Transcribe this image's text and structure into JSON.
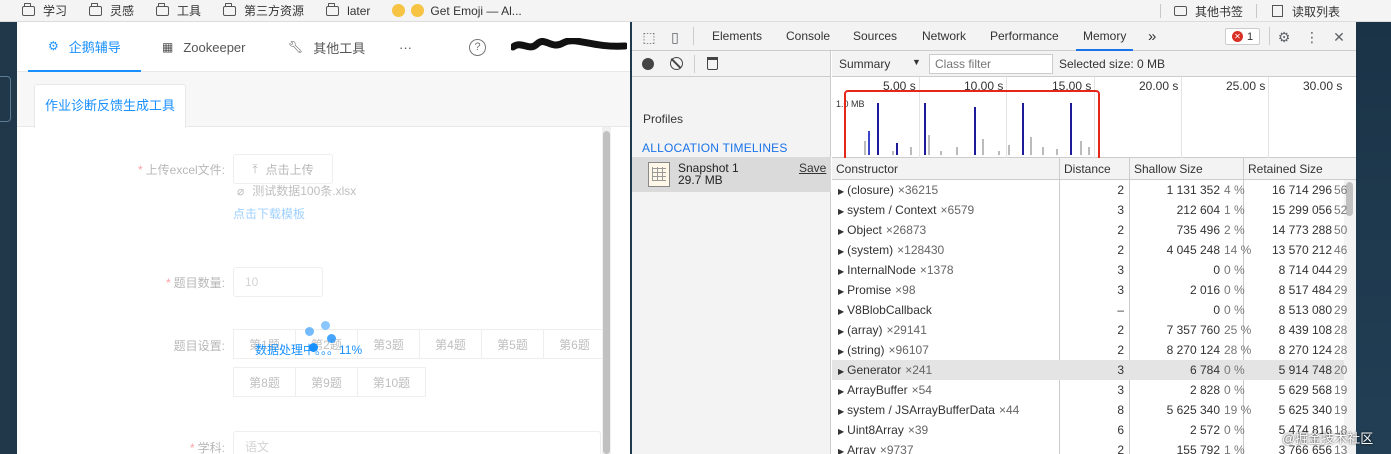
{
  "bookmarks": {
    "items": [
      "学习",
      "灵感",
      "工具",
      "第三方资源",
      "later",
      "Get Emoji — Al..."
    ],
    "right": [
      "其他书签",
      "读取列表"
    ]
  },
  "app": {
    "nav": [
      {
        "label": "企鹅辅导",
        "icon": "penguin-icon"
      },
      {
        "label": "Zookeeper",
        "icon": "grid-icon"
      },
      {
        "label": "其他工具",
        "icon": "wrench-icon"
      },
      {
        "label": "···",
        "icon": ""
      }
    ],
    "help_glyph": "?",
    "tab_label": "作业诊断反馈生成工具",
    "form": {
      "upload_label": "上传excel文件:",
      "upload_button": "点击上传",
      "file_name": "测试数据100条.xlsx",
      "download_link": "点击下载模板",
      "count_label": "题目数量:",
      "count_value": "10",
      "settings_label": "题目设置:",
      "questions_row1": [
        "第1题",
        "第2题",
        "第3题",
        "第4题",
        "第5题",
        "第6题"
      ],
      "questions_row2": [
        "第8题",
        "第9题",
        "第10题"
      ],
      "subject_label": "学科:",
      "subject_placeholder": "语文"
    },
    "loading_text": "数据处理中。。。11%"
  },
  "devtools": {
    "tabs": [
      "Elements",
      "Console",
      "Sources",
      "Network",
      "Performance",
      "Memory"
    ],
    "active_tab": "Memory",
    "more": "»",
    "error_count": "1",
    "view_select": "Summary",
    "class_filter_placeholder": "Class filter",
    "selected_size": "Selected size: 0 MB",
    "profiles_heading": "Profiles",
    "section_heading": "ALLOCATION TIMELINES",
    "snapshot": {
      "name": "Snapshot 1",
      "size": "29.7 MB",
      "save": "Save"
    },
    "timeline": {
      "ticks": [
        "5.00 s",
        "10.00 s",
        "15.00 s",
        "20.00 s",
        "25.00 s",
        "30.00 s"
      ],
      "scale_label": "1.0 MB"
    },
    "columns": [
      "Constructor",
      "Distance",
      "Shallow Size",
      "Retained Size"
    ],
    "rows": [
      {
        "name": "(closure)",
        "count": "×36215",
        "distance": "2",
        "shallow": "1 131 352",
        "shallow_pct": "4 %",
        "retained": "16 714 296",
        "retained_pct": "56"
      },
      {
        "name": "system / Context",
        "count": "×6579",
        "distance": "3",
        "shallow": "212 604",
        "shallow_pct": "1 %",
        "retained": "15 299 056",
        "retained_pct": "52"
      },
      {
        "name": "Object",
        "count": "×26873",
        "distance": "2",
        "shallow": "735 496",
        "shallow_pct": "2 %",
        "retained": "14 773 288",
        "retained_pct": "50"
      },
      {
        "name": "(system)",
        "count": "×128430",
        "distance": "2",
        "shallow": "4 045 248",
        "shallow_pct": "14 %",
        "retained": "13 570 212",
        "retained_pct": "46"
      },
      {
        "name": "InternalNode",
        "count": "×1378",
        "distance": "3",
        "shallow": "0",
        "shallow_pct": "0 %",
        "retained": "8 714 044",
        "retained_pct": "29"
      },
      {
        "name": "Promise",
        "count": "×98",
        "distance": "3",
        "shallow": "2 016",
        "shallow_pct": "0 %",
        "retained": "8 517 484",
        "retained_pct": "29"
      },
      {
        "name": "V8BlobCallback",
        "count": "",
        "distance": "–",
        "shallow": "0",
        "shallow_pct": "0 %",
        "retained": "8 513 080",
        "retained_pct": "29"
      },
      {
        "name": "(array)",
        "count": "×29141",
        "distance": "2",
        "shallow": "7 357 760",
        "shallow_pct": "25 %",
        "retained": "8 439 108",
        "retained_pct": "28"
      },
      {
        "name": "(string)",
        "count": "×96107",
        "distance": "2",
        "shallow": "8 270 124",
        "shallow_pct": "28 %",
        "retained": "8 270 124",
        "retained_pct": "28"
      },
      {
        "name": "Generator",
        "count": "×241",
        "distance": "3",
        "shallow": "6 784",
        "shallow_pct": "0 %",
        "retained": "5 914 748",
        "retained_pct": "20"
      },
      {
        "name": "ArrayBuffer",
        "count": "×54",
        "distance": "3",
        "shallow": "2 828",
        "shallow_pct": "0 %",
        "retained": "5 629 568",
        "retained_pct": "19"
      },
      {
        "name": "system / JSArrayBufferData",
        "count": "×44",
        "distance": "8",
        "shallow": "5 625 340",
        "shallow_pct": "19 %",
        "retained": "5 625 340",
        "retained_pct": "19"
      },
      {
        "name": "Uint8Array",
        "count": "×39",
        "distance": "6",
        "shallow": "2 572",
        "shallow_pct": "0 %",
        "retained": "5 474 816",
        "retained_pct": "18"
      },
      {
        "name": "Array",
        "count": "×9737",
        "distance": "2",
        "shallow": "155 792",
        "shallow_pct": "1 %",
        "retained": "3 766 656",
        "retained_pct": "13"
      }
    ],
    "selected_row": "Generator"
  },
  "watermark": "@掘金技术社区"
}
